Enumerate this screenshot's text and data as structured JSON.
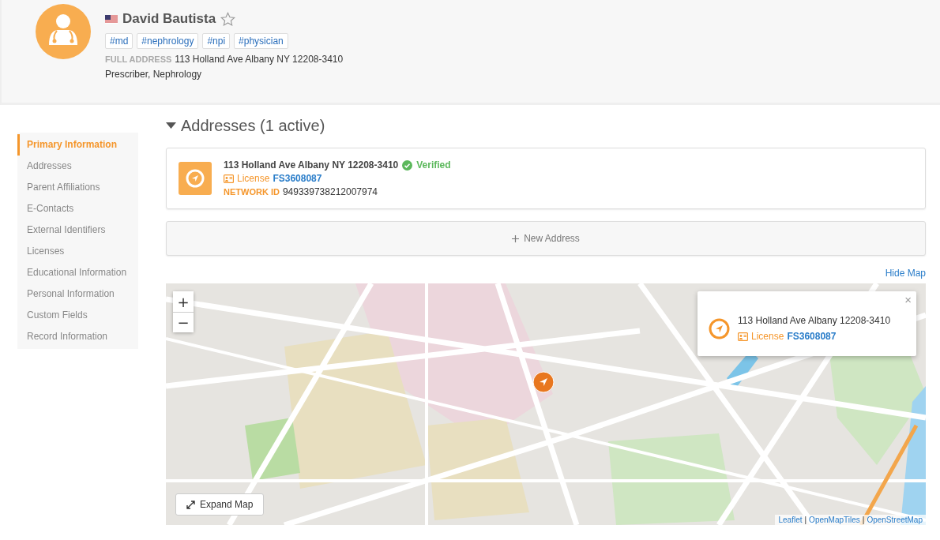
{
  "profile": {
    "name": "David Bautista",
    "starred": false,
    "tags": [
      "#md",
      "#nephrology",
      "#npi",
      "#physician"
    ],
    "full_address_label": "FULL ADDRESS",
    "full_address": "113 Holland Ave Albany NY 12208-3410",
    "role": "Prescriber, Nephrology"
  },
  "sidebar": {
    "items": [
      {
        "label": "Primary Information",
        "selected": true
      },
      {
        "label": "Addresses",
        "selected": false
      },
      {
        "label": "Parent Affiliations",
        "selected": false
      },
      {
        "label": "E-Contacts",
        "selected": false
      },
      {
        "label": "External Identifiers",
        "selected": false
      },
      {
        "label": "Licenses",
        "selected": false
      },
      {
        "label": "Educational Information",
        "selected": false
      },
      {
        "label": "Personal Information",
        "selected": false
      },
      {
        "label": "Custom Fields",
        "selected": false
      },
      {
        "label": "Record Information",
        "selected": false
      }
    ]
  },
  "section": {
    "title": "Addresses (1 active)",
    "expanded": true
  },
  "address_card": {
    "address": "113 Holland Ave Albany NY 12208-3410",
    "verified": true,
    "verified_label": "Verified",
    "license_label": "License",
    "license_number": "FS3608087",
    "network_id_label": "NETWORK ID",
    "network_id": "949339738212007974"
  },
  "new_address_button": "New Address",
  "hide_map_link": "Hide Map",
  "map": {
    "kind": "picture",
    "zoom_in": "+",
    "zoom_out": "−",
    "popup": {
      "close": "×",
      "address": "113 Holland Ave Albany 12208-3410",
      "license_label": "License",
      "license_number": "FS3608087"
    },
    "expand_button": "Expand Map",
    "attribution": {
      "separator": "|",
      "links": [
        "Leaflet",
        "OpenMapTiles",
        "OpenStreetMap"
      ]
    }
  }
}
